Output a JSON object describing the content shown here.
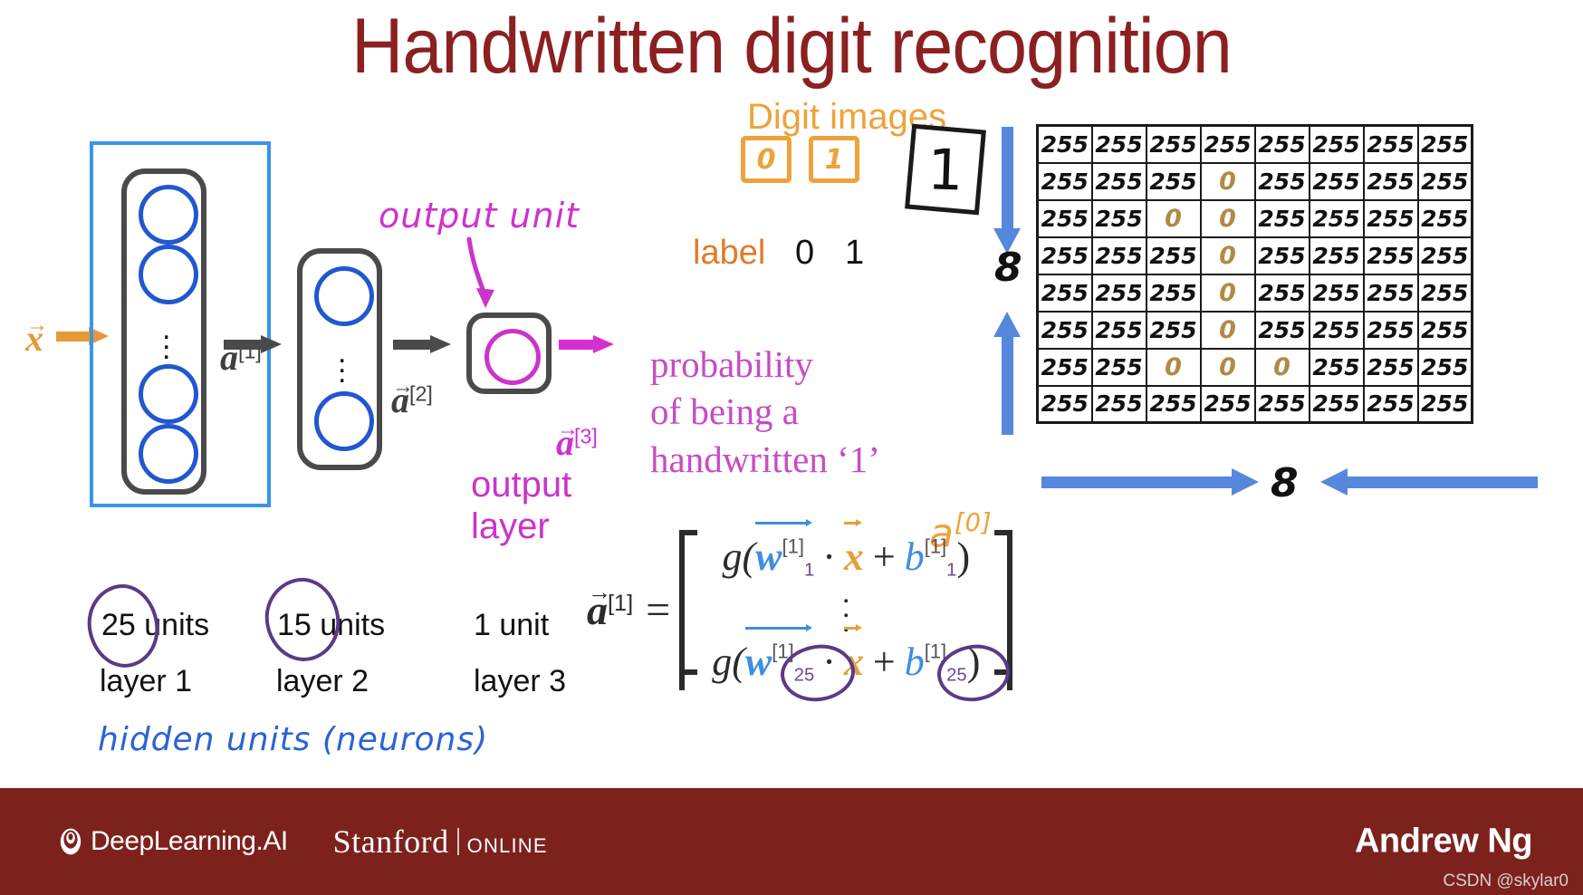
{
  "title": "Handwritten digit recognition",
  "network": {
    "input_label": "x",
    "input_sup": "",
    "activations": [
      {
        "name": "a",
        "sup": "[1]"
      },
      {
        "name": "a",
        "sup": "[2]"
      },
      {
        "name": "a",
        "sup": "[3]"
      }
    ],
    "annotations": {
      "output_unit": "output unit",
      "output_layer_line1": "output",
      "output_layer_line2": "layer",
      "probability_line1": "probability",
      "probability_line2": "of being a",
      "probability_line3": "handwritten ‘1’",
      "hidden_units": "hidden units (neurons)"
    },
    "layers": [
      {
        "units": "25 units",
        "name": "layer 1",
        "circled": true
      },
      {
        "units": "15 units",
        "name": "layer 2",
        "circled": true
      },
      {
        "units": "1 unit",
        "name": "layer 3",
        "circled": false
      }
    ]
  },
  "digits": {
    "heading": "Digit images",
    "samples": [
      "0",
      "1"
    ],
    "big_sample": "1",
    "label_word": "label",
    "labels": [
      "0",
      "1"
    ]
  },
  "pixel_grid": {
    "rows": [
      [
        "255",
        "255",
        "255",
        "255",
        "255",
        "255",
        "255",
        "255"
      ],
      [
        "255",
        "255",
        "255",
        "0",
        "255",
        "255",
        "255",
        "255"
      ],
      [
        "255",
        "255",
        "0",
        "0",
        "255",
        "255",
        "255",
        "255"
      ],
      [
        "255",
        "255",
        "255",
        "0",
        "255",
        "255",
        "255",
        "255"
      ],
      [
        "255",
        "255",
        "255",
        "0",
        "255",
        "255",
        "255",
        "255"
      ],
      [
        "255",
        "255",
        "255",
        "0",
        "255",
        "255",
        "255",
        "255"
      ],
      [
        "255",
        "255",
        "0",
        "0",
        "0",
        "255",
        "255",
        "255"
      ],
      [
        "255",
        "255",
        "255",
        "255",
        "255",
        "255",
        "255",
        "255"
      ]
    ],
    "height_label": "8",
    "width_label": "8",
    "zero_value": "0"
  },
  "formula": {
    "lhs": "a",
    "lhs_sup": "[1]",
    "equals": "=",
    "a0_annotation": "a",
    "a0_annotation_sup": "[0]",
    "row_top": {
      "g": "g(",
      "w": "w",
      "w_sup": "[1]",
      "w_sub": "1",
      "dot": "·",
      "x": "x",
      "plus": "+",
      "b": "b",
      "b_sup": "[1]",
      "b_sub": "1",
      "close": ")"
    },
    "row_bottom": {
      "g": "g(",
      "w": "w",
      "w_sup": "[1]",
      "w_sub": "25",
      "dot": "·",
      "x": "x",
      "plus": "+",
      "b": "b",
      "b_sup": "[1]",
      "b_sub": "25",
      "close": ")"
    }
  },
  "footer": {
    "deeplearning": "DeepLearning.AI",
    "stanford": "Stanford",
    "online": "ONLINE",
    "presenter": "Andrew Ng",
    "watermark": "CSDN @skylar0"
  },
  "colors": {
    "title_red": "#8c2020",
    "footer_red": "#7d211c",
    "neuron_blue": "#2157cf",
    "highlight_blue": "#3a95ea",
    "magenta": "#cc33cc",
    "orange": "#eda33a",
    "purple": "#5b3a86",
    "measure_blue": "#5588dd",
    "zero_tan": "#b08b44"
  }
}
